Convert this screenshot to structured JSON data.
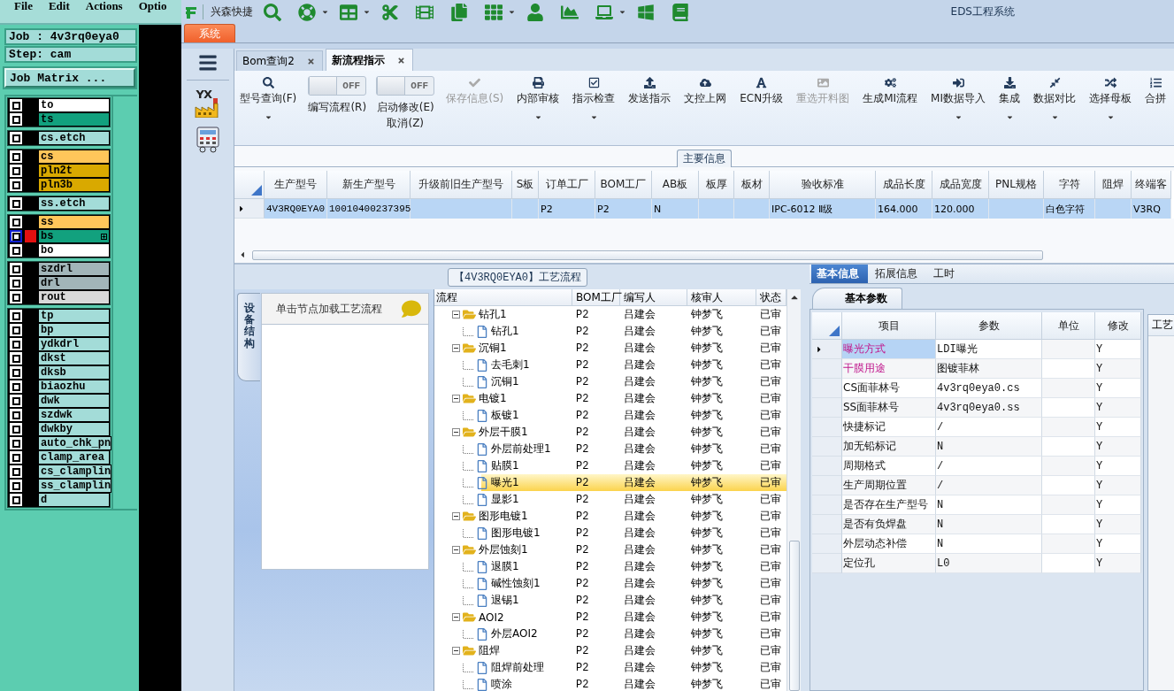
{
  "cam": {
    "menu": [
      "File",
      "Edit",
      "Actions",
      "Optio"
    ],
    "job": "Job : 4v3rq0eya0",
    "step": "Step: cam",
    "matrix_button": "Job Matrix ...",
    "layer_groups": [
      {
        "layers": [
          {
            "name": "to",
            "color": "#ffffff",
            "selected": false
          },
          {
            "name": "ts",
            "color": "#12a17e",
            "selected": false
          }
        ]
      },
      {
        "layers": [
          {
            "name": "cs.etch",
            "color": "#a3dcd8",
            "selected": false
          }
        ]
      },
      {
        "layers": [
          {
            "name": "cs",
            "color": "#ffc65a",
            "selected": false
          },
          {
            "name": "pln2t",
            "color": "#d9a900",
            "selected": false
          },
          {
            "name": "pln3b",
            "color": "#d9a900",
            "selected": false
          }
        ]
      },
      {
        "layers": [
          {
            "name": "ss.etch",
            "color": "#a3dcd8",
            "selected": false
          }
        ]
      },
      {
        "layers": [
          {
            "name": "ss",
            "color": "#ffc65a",
            "selected": false
          },
          {
            "name": "bs",
            "color": "#12a17e",
            "selected": true
          },
          {
            "name": "bo",
            "color": "#ffffff",
            "selected": false
          }
        ]
      },
      {
        "layers": [
          {
            "name": "szdrl",
            "color": "#a2b5b9",
            "selected": false
          },
          {
            "name": "drl",
            "color": "#a2b5b9",
            "selected": false
          },
          {
            "name": "rout",
            "color": "#d9d9d9",
            "selected": false
          }
        ]
      },
      {
        "layers": [
          {
            "name": "tp",
            "color": "#a3dcd8",
            "selected": false
          },
          {
            "name": "bp",
            "color": "#a3dcd8",
            "selected": false
          },
          {
            "name": "ydkdrl",
            "color": "#a3dcd8",
            "selected": false
          },
          {
            "name": "dkst",
            "color": "#a3dcd8",
            "selected": false
          },
          {
            "name": "dksb",
            "color": "#a3dcd8",
            "selected": false
          },
          {
            "name": "biaozhu",
            "color": "#a3dcd8",
            "selected": false
          },
          {
            "name": "dwk",
            "color": "#a3dcd8",
            "selected": false
          },
          {
            "name": "szdwk",
            "color": "#a3dcd8",
            "selected": false
          },
          {
            "name": "dwkby",
            "color": "#a3dcd8",
            "selected": false
          },
          {
            "name": "auto_chk_pn",
            "color": "#a3dcd8",
            "selected": false
          },
          {
            "name": "clamp_area",
            "color": "#a3dcd8",
            "selected": false
          },
          {
            "name": "cs_clamplin",
            "color": "#a3dcd8",
            "selected": false
          },
          {
            "name": "ss_clamplin",
            "color": "#a3dcd8",
            "selected": false
          },
          {
            "name": "d",
            "color": "#a3dcd8",
            "selected": false
          }
        ]
      }
    ]
  },
  "app": {
    "title": "EDS工程系统",
    "quick_label": "兴森快捷",
    "ribbon_tab": "系统"
  },
  "sidebar": {
    "app_badge": "YX"
  },
  "doc_tabs": [
    {
      "label": "Bom查询2",
      "selected": false
    },
    {
      "label": "新流程指示",
      "selected": true
    }
  ],
  "toolbar": [
    {
      "kind": "button",
      "label": "型号查询(F)",
      "disabled": false,
      "dropdown": true
    },
    {
      "kind": "toggle",
      "label": "编写流程(R)",
      "switch_text": "OFF",
      "on": false
    },
    {
      "kind": "toggle",
      "label": "启动修改(E)",
      "sublabel": "取消(Z)",
      "switch_text": "OFF",
      "on": false
    },
    {
      "kind": "button",
      "label": "保存信息(S)",
      "disabled": true,
      "dropdown": false
    },
    {
      "kind": "button",
      "label": "内部审核",
      "disabled": false,
      "dropdown": true
    },
    {
      "kind": "button",
      "label": "指示检查",
      "disabled": false,
      "dropdown": true
    },
    {
      "kind": "button",
      "label": "发送指示",
      "disabled": false,
      "dropdown": false
    },
    {
      "kind": "button",
      "label": "文控上网",
      "disabled": false,
      "dropdown": false
    },
    {
      "kind": "button",
      "label": "ECN升级",
      "disabled": false,
      "dropdown": false
    },
    {
      "kind": "button",
      "label": "重选开料图",
      "disabled": true,
      "dropdown": false
    },
    {
      "kind": "button",
      "label": "生成MI流程",
      "disabled": false,
      "dropdown": false
    },
    {
      "kind": "button",
      "label": "MI数据导入",
      "disabled": false,
      "dropdown": true
    },
    {
      "kind": "button",
      "label": "集成",
      "disabled": false,
      "dropdown": true
    },
    {
      "kind": "button",
      "label": "数据对比",
      "disabled": false,
      "dropdown": true
    },
    {
      "kind": "button",
      "label": "选择母板",
      "disabled": false,
      "dropdown": true
    },
    {
      "kind": "button",
      "label": "合拼",
      "disabled": false,
      "dropdown": false
    }
  ],
  "main_info": {
    "title": "主要信息",
    "columns": [
      "生产型号",
      "新生产型号",
      "升级前旧生产型号",
      "S板",
      "订单工厂",
      "BOM工厂",
      "AB板",
      "板厚",
      "板材",
      "验收标准",
      "成品长度",
      "成品宽度",
      "PNL规格",
      "字符",
      "阻焊",
      "终端客"
    ],
    "rows": [
      {
        "selected": true,
        "cells": [
          "4V3RQ0EYA0",
          "10010400237395",
          null,
          null,
          "P2",
          "P2",
          "N",
          null,
          null,
          "IPC-6012 Ⅱ级",
          "164.000",
          "120.000",
          null,
          "白色字符",
          null,
          "V3RQ"
        ]
      }
    ]
  },
  "process": {
    "title": "【4V3RQ0EYA0】工艺流程",
    "side_tab": "设备结构",
    "hint": "单击节点加载工艺流程",
    "columns": [
      "流程",
      "BOM工厂",
      "编写人",
      "核审人",
      "状态"
    ],
    "tree": [
      {
        "name": "钻孔1",
        "bom": "P2",
        "writer": "吕建会",
        "reviewer": "钟梦飞",
        "status": "已审",
        "expanded": true,
        "selected": false,
        "children": [
          {
            "name": "钻孔1",
            "bom": "P2",
            "writer": "吕建会",
            "reviewer": "钟梦飞",
            "status": "已审",
            "selected": false
          }
        ]
      },
      {
        "name": "沉铜1",
        "bom": "P2",
        "writer": "吕建会",
        "reviewer": "钟梦飞",
        "status": "已审",
        "expanded": true,
        "selected": false,
        "children": [
          {
            "name": "去毛刺1",
            "bom": "P2",
            "writer": "吕建会",
            "reviewer": "钟梦飞",
            "status": "已审",
            "selected": false
          },
          {
            "name": "沉铜1",
            "bom": "P2",
            "writer": "吕建会",
            "reviewer": "钟梦飞",
            "status": "已审",
            "selected": false
          }
        ]
      },
      {
        "name": "电镀1",
        "bom": "P2",
        "writer": "吕建会",
        "reviewer": "钟梦飞",
        "status": "已审",
        "expanded": true,
        "selected": false,
        "children": [
          {
            "name": "板镀1",
            "bom": "P2",
            "writer": "吕建会",
            "reviewer": "钟梦飞",
            "status": "已审",
            "selected": false
          }
        ]
      },
      {
        "name": "外层干膜1",
        "bom": "P2",
        "writer": "吕建会",
        "reviewer": "钟梦飞",
        "status": "已审",
        "expanded": true,
        "selected": false,
        "children": [
          {
            "name": "外层前处理1",
            "bom": "P2",
            "writer": "吕建会",
            "reviewer": "钟梦飞",
            "status": "已审",
            "selected": false
          },
          {
            "name": "贴膜1",
            "bom": "P2",
            "writer": "吕建会",
            "reviewer": "钟梦飞",
            "status": "已审",
            "selected": false
          },
          {
            "name": "曝光1",
            "bom": "P2",
            "writer": "吕建会",
            "reviewer": "钟梦飞",
            "status": "已审",
            "selected": true
          },
          {
            "name": "显影1",
            "bom": "P2",
            "writer": "吕建会",
            "reviewer": "钟梦飞",
            "status": "已审",
            "selected": false
          }
        ]
      },
      {
        "name": "图形电镀1",
        "bom": "P2",
        "writer": "吕建会",
        "reviewer": "钟梦飞",
        "status": "已审",
        "expanded": true,
        "selected": false,
        "children": [
          {
            "name": "图形电镀1",
            "bom": "P2",
            "writer": "吕建会",
            "reviewer": "钟梦飞",
            "status": "已审",
            "selected": false
          }
        ]
      },
      {
        "name": "外层蚀刻1",
        "bom": "P2",
        "writer": "吕建会",
        "reviewer": "钟梦飞",
        "status": "已审",
        "expanded": true,
        "selected": false,
        "children": [
          {
            "name": "退膜1",
            "bom": "P2",
            "writer": "吕建会",
            "reviewer": "钟梦飞",
            "status": "已审",
            "selected": false
          },
          {
            "name": "碱性蚀刻1",
            "bom": "P2",
            "writer": "吕建会",
            "reviewer": "钟梦飞",
            "status": "已审",
            "selected": false
          },
          {
            "name": "退锡1",
            "bom": "P2",
            "writer": "吕建会",
            "reviewer": "钟梦飞",
            "status": "已审",
            "selected": false
          }
        ]
      },
      {
        "name": "AOI2",
        "bom": "P2",
        "writer": "吕建会",
        "reviewer": "钟梦飞",
        "status": "已审",
        "expanded": true,
        "selected": false,
        "children": [
          {
            "name": "外层AOI2",
            "bom": "P2",
            "writer": "吕建会",
            "reviewer": "钟梦飞",
            "status": "已审",
            "selected": false
          }
        ]
      },
      {
        "name": "阻焊",
        "bom": "P2",
        "writer": "吕建会",
        "reviewer": "钟梦飞",
        "status": "已审",
        "expanded": true,
        "selected": false,
        "children": [
          {
            "name": "阻焊前处理",
            "bom": "P2",
            "writer": "吕建会",
            "reviewer": "钟梦飞",
            "status": "已审",
            "selected": false
          },
          {
            "name": "喷涂",
            "bom": "P2",
            "writer": "吕建会",
            "reviewer": "钟梦飞",
            "status": "已审",
            "selected": false
          }
        ]
      }
    ]
  },
  "params": {
    "tabs": [
      {
        "label": "基本信息",
        "selected": true
      },
      {
        "label": "拓展信息",
        "selected": false
      },
      {
        "label": "工时",
        "selected": false
      }
    ],
    "subtab": "基本参数",
    "side_header": "工艺",
    "columns": [
      "项目",
      "参数",
      "单位",
      "修改"
    ],
    "rows": [
      {
        "item": "曝光方式",
        "value": "LDI曝光",
        "modify": "Y",
        "flagged": true,
        "selected": true
      },
      {
        "item": "干膜用途",
        "value": "图镀菲林",
        "modify": "Y",
        "flagged": true,
        "selected": false
      },
      {
        "item": "CS面菲林号",
        "value": "4v3rq0eya0.cs",
        "modify": "Y",
        "flagged": false,
        "selected": false
      },
      {
        "item": "SS面菲林号",
        "value": "4v3rq0eya0.ss",
        "modify": "Y",
        "flagged": false,
        "selected": false
      },
      {
        "item": "快捷标记",
        "value": "/",
        "modify": "Y",
        "flagged": false,
        "selected": false
      },
      {
        "item": "加无铅标记",
        "value": "N",
        "modify": "Y",
        "flagged": false,
        "selected": false
      },
      {
        "item": "周期格式",
        "value": "/",
        "modify": "Y",
        "flagged": false,
        "selected": false
      },
      {
        "item": "生产周期位置",
        "value": "/",
        "modify": "Y",
        "flagged": false,
        "selected": false
      },
      {
        "item": "是否存在生产型号",
        "value": "N",
        "modify": "Y",
        "flagged": false,
        "selected": false
      },
      {
        "item": "是否有负焊盘",
        "value": "N",
        "modify": "Y",
        "flagged": false,
        "selected": false
      },
      {
        "item": "外层动态补偿",
        "value": "N",
        "modify": "Y",
        "flagged": false,
        "selected": false
      },
      {
        "item": "定位孔",
        "value": "L0",
        "modify": "Y",
        "flagged": false,
        "selected": false
      }
    ]
  }
}
